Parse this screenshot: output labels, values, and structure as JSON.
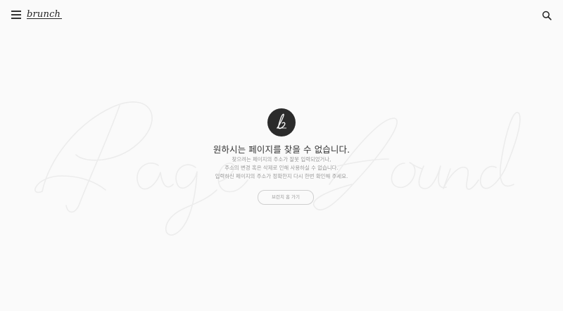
{
  "header": {
    "logo_text": "brunch",
    "menu_icon": "hamburger-menu-icon",
    "search_icon": "search-icon"
  },
  "background": {
    "script_text": "Page not found"
  },
  "main": {
    "badge_icon": "brunch-b-logo-icon",
    "title": "원하시는 페이지를 찾을 수 없습니다.",
    "description_lines": [
      "찾으려는 페이지의 주소가 잘못 입력되었거나,",
      "주소의 변경 혹은 삭제로 인해 사용하실 수 없습니다.",
      "입력하신 페이지의 주소가 정확한지 다시 한번 확인해 주세요."
    ],
    "back_button_label": "브런치 홈 가기"
  },
  "colors": {
    "background": "#fafafa",
    "badge": "#2b2b2b",
    "text_dark": "#333333",
    "text_light": "#9a9a9a",
    "script_stroke": "#efefef"
  }
}
